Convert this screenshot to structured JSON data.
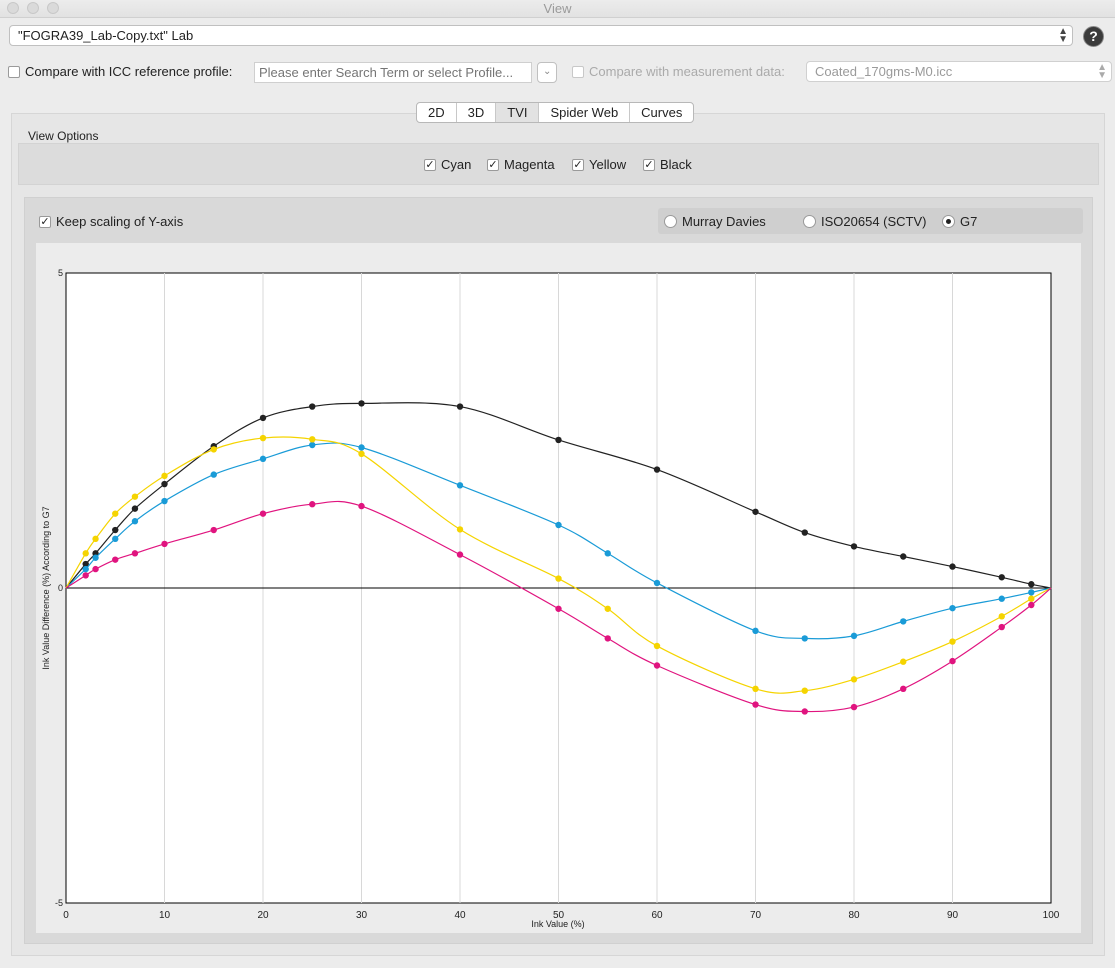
{
  "window": {
    "title": "View"
  },
  "profile_select": {
    "value": "\"FOGRA39_Lab-Copy.txt\" Lab"
  },
  "help": {
    "label": "?"
  },
  "compare_icc": {
    "label": "Compare with ICC reference profile:",
    "checked": false,
    "placeholder": "Please enter Search Term or select Profile..."
  },
  "compare_measurement": {
    "label": "Compare with measurement data:",
    "checked": false,
    "value": "Coated_170gms-M0.icc"
  },
  "tabs": [
    {
      "label": "2D"
    },
    {
      "label": "3D"
    },
    {
      "label": "TVI",
      "active": true
    },
    {
      "label": "Spider Web"
    },
    {
      "label": "Curves"
    }
  ],
  "view_options": {
    "title": "View Options",
    "channels": [
      {
        "label": "Cyan",
        "checked": true
      },
      {
        "label": "Magenta",
        "checked": true
      },
      {
        "label": "Yellow",
        "checked": true
      },
      {
        "label": "Black",
        "checked": true
      }
    ]
  },
  "keep_scaling": {
    "label": "Keep scaling of Y-axis",
    "checked": true
  },
  "methods": [
    {
      "label": "Murray Davies",
      "selected": false
    },
    {
      "label": "ISO20654 (SCTV)",
      "selected": false
    },
    {
      "label": "G7",
      "selected": true
    }
  ],
  "chart_data": {
    "type": "line",
    "xlabel": "Ink Value (%)",
    "ylabel": "Ink Value Difference (%) According to G7",
    "xlim": [
      0,
      100
    ],
    "ylim": [
      -5,
      5
    ],
    "xticks": [
      0,
      10,
      20,
      30,
      40,
      50,
      60,
      70,
      80,
      90,
      100
    ],
    "yticks": [
      -5,
      0,
      5
    ],
    "grid": "vertical",
    "series": [
      {
        "name": "Black",
        "color": "#222222",
        "x": [
          0,
          2,
          3,
          5,
          7,
          10,
          15,
          20,
          25,
          30,
          40,
          50,
          60,
          70,
          75,
          80,
          85,
          90,
          95,
          98,
          100
        ],
        "y": [
          0,
          0.38,
          0.55,
          0.92,
          1.26,
          1.65,
          2.25,
          2.7,
          2.88,
          2.93,
          2.88,
          2.35,
          1.88,
          1.21,
          0.88,
          0.66,
          0.5,
          0.34,
          0.17,
          0.06,
          0
        ]
      },
      {
        "name": "Cyan",
        "color": "#1a9bd7",
        "x": [
          0,
          2,
          3,
          5,
          7,
          10,
          15,
          20,
          25,
          30,
          40,
          50,
          55,
          60,
          70,
          75,
          80,
          85,
          90,
          95,
          98,
          100
        ],
        "y": [
          0,
          0.3,
          0.48,
          0.78,
          1.06,
          1.38,
          1.8,
          2.05,
          2.27,
          2.23,
          1.63,
          1.0,
          0.55,
          0.08,
          -0.68,
          -0.8,
          -0.76,
          -0.53,
          -0.32,
          -0.17,
          -0.07,
          0
        ]
      },
      {
        "name": "Yellow",
        "color": "#f5d400",
        "x": [
          0,
          2,
          3,
          5,
          7,
          10,
          15,
          20,
          25,
          30,
          40,
          50,
          55,
          60,
          70,
          75,
          80,
          85,
          90,
          95,
          98,
          100
        ],
        "y": [
          0,
          0.55,
          0.78,
          1.18,
          1.45,
          1.78,
          2.2,
          2.38,
          2.36,
          2.13,
          0.93,
          0.15,
          -0.33,
          -0.92,
          -1.6,
          -1.63,
          -1.45,
          -1.17,
          -0.85,
          -0.45,
          -0.17,
          0
        ]
      },
      {
        "name": "Magenta",
        "color": "#e0147f",
        "x": [
          0,
          2,
          3,
          5,
          7,
          10,
          15,
          20,
          25,
          30,
          40,
          50,
          55,
          60,
          70,
          75,
          80,
          85,
          90,
          95,
          98,
          100
        ],
        "y": [
          0,
          0.2,
          0.3,
          0.45,
          0.55,
          0.7,
          0.92,
          1.18,
          1.33,
          1.3,
          0.53,
          -0.33,
          -0.8,
          -1.23,
          -1.85,
          -1.96,
          -1.89,
          -1.6,
          -1.16,
          -0.62,
          -0.27,
          0
        ]
      }
    ]
  }
}
